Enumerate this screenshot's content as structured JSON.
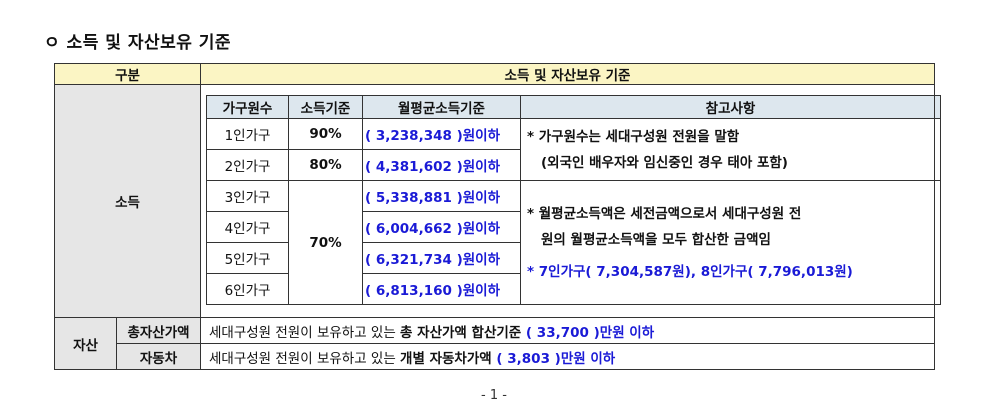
{
  "title": "ㅇ 소득 및 자산보유 기준",
  "header": {
    "col1": "구분",
    "col2": "소득 및 자산보유 기준"
  },
  "income": {
    "label": "소득",
    "columns": [
      "가구원수",
      "소득기준",
      "월평균소득기준",
      "참고사항"
    ],
    "rows": [
      {
        "size": "1인가구",
        "pct": "90%",
        "amount": "( 3,238,348 )원이하"
      },
      {
        "size": "2인가구",
        "pct": "80%",
        "amount": "( 4,381,602 )원이하"
      },
      {
        "size": "3인가구",
        "pct": "70%",
        "amount": "( 5,338,881 )원이하"
      },
      {
        "size": "4인가구",
        "pct": "",
        "amount": "( 6,004,662 )원이하"
      },
      {
        "size": "5인가구",
        "pct": "",
        "amount": "( 6,321,734 )원이하"
      },
      {
        "size": "6인가구",
        "pct": "",
        "amount": "( 6,813,160 )원이하"
      }
    ],
    "notes": {
      "n1a": "* 가구원수는 세대구성원 전원을 말함",
      "n1b": "(외국인 배우자와 임신중인 경우 태아 포함)",
      "n2a": "* 월평균소득액은 세전금액으로서 세대구성원 전",
      "n2b": "원의 월평균소득액을 모두 합산한 금액임",
      "n3": "* 7인가구( 7,304,587원), 8인가구( 7,796,013원)"
    }
  },
  "assets": {
    "label": "자산",
    "total": {
      "name": "총자산가액",
      "prefix": "세대구성원 전원이 보유하고 있는 ",
      "bold": "총 자산가액 합산기준",
      "value": " ( 33,700 )만원 이하"
    },
    "car": {
      "name": "자동차",
      "prefix": "세대구성원 전원이 보유하고 있는 ",
      "bold": "개별 자동차가액",
      "value": " ( 3,803 )만원 이하"
    }
  },
  "page_number": "- 1 -"
}
